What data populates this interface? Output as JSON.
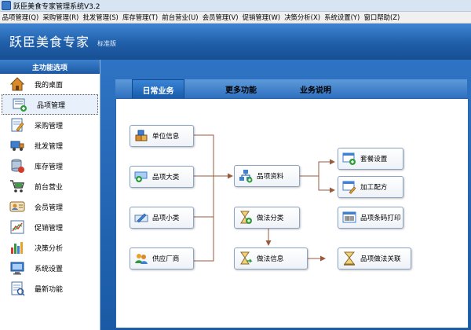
{
  "window": {
    "title": "跃臣美食专家管理系统V3.2"
  },
  "menu": [
    "品项管理(Q)",
    "采购管理(R)",
    "批发管理(S)",
    "库存管理(T)",
    "前台营业(U)",
    "会员管理(V)",
    "促销管理(W)",
    "决策分析(X)",
    "系统设置(Y)",
    "窗口帮助(Z)"
  ],
  "banner": {
    "brand": "跃臣美食专家",
    "edition": "标准版"
  },
  "sidebar": {
    "title": "主功能选项",
    "items": [
      {
        "label": "我的桌面",
        "icon": "home-icon"
      },
      {
        "label": "品项管理",
        "icon": "item-management-icon"
      },
      {
        "label": "采购管理",
        "icon": "purchase-icon"
      },
      {
        "label": "批发管理",
        "icon": "wholesale-icon"
      },
      {
        "label": "库存管理",
        "icon": "inventory-icon"
      },
      {
        "label": "前台营业",
        "icon": "cart-icon"
      },
      {
        "label": "会员管理",
        "icon": "member-icon"
      },
      {
        "label": "促销管理",
        "icon": "promotion-icon"
      },
      {
        "label": "决策分析",
        "icon": "bar-chart-icon"
      },
      {
        "label": "系统设置",
        "icon": "computer-icon"
      },
      {
        "label": "最新功能",
        "icon": "document-icon"
      }
    ],
    "active_index": 1
  },
  "tabs": [
    "日常业务",
    "更多功能",
    "业务说明"
  ],
  "active_tab": 0,
  "flow": {
    "unit_info": "单位信息",
    "item_category": "品项大类",
    "item_subcategory": "品项小类",
    "supplier": "供应厂商",
    "item_data": "品项资料",
    "method_category": "做法分类",
    "method_info": "做法信息",
    "combo_settings": "套餐设置",
    "recipe": "加工配方",
    "barcode_print": "品项条码打印",
    "method_link": "品项做法关联"
  },
  "colors": {
    "banner": "#1f5ea8",
    "arrow": "#9a5a3c",
    "accent": "#3a84d6"
  }
}
